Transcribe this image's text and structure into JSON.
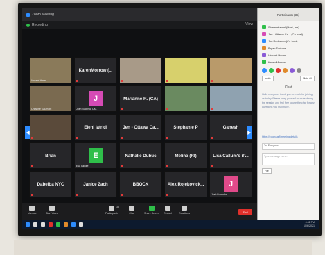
{
  "window": {
    "title": "Zoom Meeting",
    "recording_label": "Recording",
    "view_label": "View"
  },
  "grid": {
    "tiles": [
      {
        "label": "",
        "name": "Vincent Heren",
        "kind": "video",
        "color": "#8a7a5a"
      },
      {
        "label": "KarenMorrow (...",
        "name": "",
        "kind": "text"
      },
      {
        "label": "",
        "name": "",
        "kind": "video",
        "color": "#a89a88"
      },
      {
        "label": "",
        "name": "",
        "kind": "video",
        "color": "#d7d06c"
      },
      {
        "label": "",
        "name": "",
        "kind": "video",
        "color": "#b99a6a"
      },
      {
        "label": "",
        "name": "Christine Gaumont",
        "kind": "video",
        "color": "#7a6a50"
      },
      {
        "label": "",
        "name": "Josh Bucenka Ca...",
        "kind": "avatar",
        "avatar_letter": "J",
        "avatar_color": "#d64bb5"
      },
      {
        "label": "Marianne R. (CA)",
        "name": "",
        "kind": "text"
      },
      {
        "label": "",
        "name": "",
        "kind": "video",
        "color": "#6a8a60"
      },
      {
        "label": "",
        "name": "",
        "kind": "video",
        "color": "#8fa2b0"
      },
      {
        "label": "",
        "name": "",
        "kind": "video",
        "color": "#5a4a3a"
      },
      {
        "label": "Eleni Iatridi",
        "name": "",
        "kind": "text"
      },
      {
        "label": "Jen - Ottawa Ca...",
        "name": "",
        "kind": "text"
      },
      {
        "label": "Stephanie P",
        "name": "",
        "kind": "text"
      },
      {
        "label": "Ganesh",
        "name": "",
        "kind": "text"
      },
      {
        "label": "Brian",
        "name": "",
        "kind": "text"
      },
      {
        "label": "",
        "name": "Eva Isidore",
        "kind": "avatar",
        "avatar_letter": "E",
        "avatar_color": "#2fbf4a"
      },
      {
        "label": "Nathalie Dubuc",
        "name": "",
        "kind": "text"
      },
      {
        "label": "Melina (RI)",
        "name": "",
        "kind": "text"
      },
      {
        "label": "Lisa Callum's iP...",
        "name": "",
        "kind": "text"
      },
      {
        "label": "Dabelba NYC",
        "name": "",
        "kind": "text"
      },
      {
        "label": "Janice Zach",
        "name": "",
        "kind": "text"
      },
      {
        "label": "BBOCK",
        "name": "",
        "kind": "text"
      },
      {
        "label": "Alex Rojekovick...",
        "name": "",
        "kind": "text"
      },
      {
        "label": "",
        "name": "Josh Bucenka",
        "kind": "avatar",
        "avatar_letter": "J",
        "avatar_color": "#e04a8a"
      }
    ]
  },
  "toolbar": {
    "unmute": "Unmute",
    "start_video": "Start Video",
    "participants": "Participants",
    "participant_count": "35",
    "chat": "Chat",
    "share_screen": "Share Screen",
    "record": "Record",
    "reactions": "Reactions",
    "end": "End"
  },
  "panel": {
    "title": "Participants (35)",
    "participants": [
      {
        "name": "Sharafat amal (Host, me)",
        "color": "#2fbf4a"
      },
      {
        "name": "Jen - Ottawa Ca... (Co-host)",
        "color": "#d64bb5"
      },
      {
        "name": "Jon Pedersen (Co-host)",
        "color": "#2d8cff"
      },
      {
        "name": "Bryan Fortune",
        "color": "#e08a2b"
      },
      {
        "name": "Vincent Heren",
        "color": "#8a5ad6"
      },
      {
        "name": "Karen Morrow",
        "color": "#2fbf4a"
      }
    ],
    "invite": "Invite",
    "mute_all": "Mute All",
    "chat_title": "Chat",
    "chat_message": "Hello everyone, thank you so much for joining us today. Please keep yourself on mute during the session and feel free to use the chat for any questions you may have.",
    "chat_link": "https://zoom.us/j/meeting-details",
    "to_label": "To: Everyone",
    "input_placeholder": "Type message here...",
    "file_label": "File"
  },
  "taskbar": {
    "time": "4:42 PM",
    "date": "10/6/2021"
  },
  "colors": {
    "accent": "#2d8cff",
    "end_red": "#e0302b",
    "bg": "#0f1012"
  }
}
